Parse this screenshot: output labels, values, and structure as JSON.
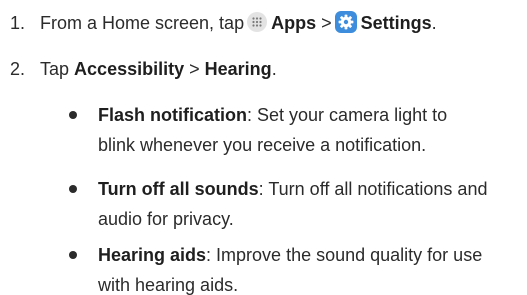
{
  "steps": [
    {
      "number": "1.",
      "prefix": "From a Home screen, tap",
      "apps_icon": "apps-grid-icon",
      "apps_label": "Apps",
      "separator": ">",
      "settings_icon": "settings-gear-icon",
      "settings_label": "Settings",
      "suffix": "."
    },
    {
      "number": "2.",
      "prefix": "Tap",
      "accessibility_label": "Accessibility",
      "separator": ">",
      "hearing_label": "Hearing",
      "suffix": "."
    }
  ],
  "options": [
    {
      "title": "Flash notification",
      "desc_line1": ": Set your camera light to",
      "desc_line2": "blink whenever you receive a notification."
    },
    {
      "title": "Turn off all sounds",
      "desc_line1": ": Turn off all notifications and",
      "desc_line2": "audio for privacy."
    },
    {
      "title": "Hearing aids",
      "desc_line1": ": Improve the sound quality for use",
      "desc_line2": "with hearing aids."
    }
  ],
  "colors": {
    "text": "#2b2b2b",
    "settings_icon_bg": "#3d8ddc",
    "apps_icon_bg": "#e3e3e3"
  }
}
